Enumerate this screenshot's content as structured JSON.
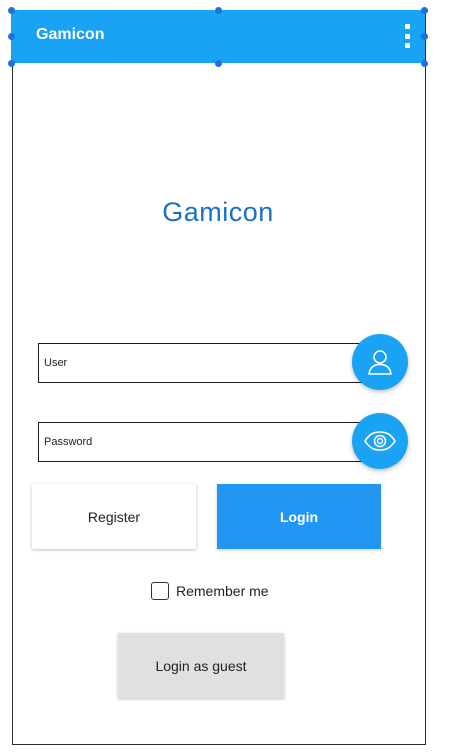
{
  "appbar": {
    "title": "Gamicon",
    "menu_icon": "more-vert-icon",
    "color": "#1aa3f5"
  },
  "brand": {
    "title": "Gamicon",
    "color": "#1a72c6"
  },
  "login_form": {
    "user_placeholder": "User",
    "password_placeholder": "Password",
    "user_icon": "user-icon",
    "password_icon": "eye-icon"
  },
  "buttons": {
    "register_label": "Register",
    "login_label": "Login",
    "guest_label": "Login as guest"
  },
  "remember": {
    "label": "Remember me",
    "checked": false
  },
  "colors": {
    "accent": "#1aa3f5",
    "primary_button": "#2296f3",
    "guest_button": "#e0e0e0"
  }
}
